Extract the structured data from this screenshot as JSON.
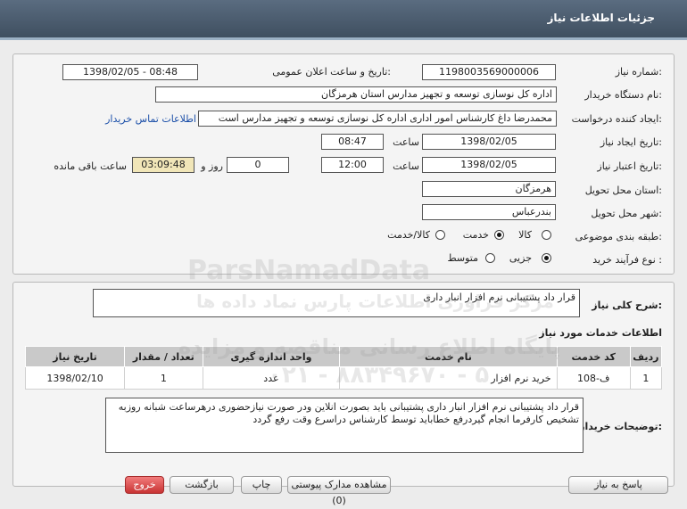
{
  "header": {
    "title": "جزئیات اطلاعات نیاز"
  },
  "form": {
    "need_number_label": "شماره نیاز:",
    "need_number": "1198003569000006",
    "announce_label": "تاریخ و ساعت اعلان عمومی:",
    "announce_value": "1398/02/05 - 08:48",
    "buyer_org_label": "نام دستگاه خریدار:",
    "buyer_org": "اداره کل نوسازی توسعه و تجهیز مدارس استان هرمزگان",
    "requester_label": "ایجاد کننده درخواست:",
    "requester": "محمدرضا داغ کارشناس امور اداری اداره کل نوسازی توسعه و تجهیز مدارس است",
    "contact_link": "اطلاعات تماس خریدار",
    "create_date_label": "تاریخ ایجاد نیاز:",
    "create_date": "1398/02/05",
    "time_label": "ساعت",
    "create_time": "08:47",
    "validity_label": "تاریخ اعتبار نیاز:",
    "validity_date": "1398/02/05",
    "validity_time": "12:00",
    "days": "0",
    "days_label": "روز و",
    "remaining": "03:09:48",
    "remaining_label": "ساعت باقی مانده",
    "province_label": "استان محل تحویل:",
    "province": "هرمزگان",
    "city_label": "شهر محل تحویل:",
    "city": "بندرعباس",
    "category_label": "طبقه بندی موضوعی:",
    "category_options": [
      "کالا",
      "خدمت",
      "کالا/خدمت"
    ],
    "category_selected": "خدمت",
    "process_label": "نوع فرآیند خرید :",
    "process_options": [
      "جزیی",
      "متوسط"
    ],
    "process_selected": "جزیی"
  },
  "summary": {
    "label": "شرح کلی نیاز:",
    "text": "قرار داد پشتیبانی نرم افزار انبار داری"
  },
  "services": {
    "title": "اطلاعات خدمات مورد نیاز",
    "columns": [
      "ردیف",
      "کد خدمت",
      "نام خدمت",
      "واحد اندازه گیری",
      "تعداد / مقدار",
      "تاریخ نیاز"
    ],
    "rows": [
      [
        "1",
        "ف-108",
        "خرید نرم افزار",
        "عدد",
        "1",
        "1398/02/10"
      ]
    ]
  },
  "buyer_desc": {
    "label": "توضیحات خریدار:",
    "text": "قرار داد پشتیبانی نرم افزار انبار داری پشتیبانی باید بصورت انلاین ودر صورت نیازحضوری درهرساعت شبانه روزبه تشخیص کارفرما انجام گیردرفع خطاباید توسط کارشناس دراسرع وقت رفع گردد"
  },
  "footer": {
    "buttons": [
      "پاسخ به نیاز",
      "مشاهده مدارک پیوستی (0)",
      "چاپ",
      "بازگشت",
      "خروج"
    ]
  },
  "watermark": {
    "brand": "ParsNamadData",
    "line1": "پایگاه اطلاع رسانی مناقصه و مزایده",
    "line2": "مرکز فراوری اطلاعات پارس نماد داده ها",
    "phone": "۰۲۱ - ۸۸۳۴۹۶۷۰ - ۵"
  }
}
